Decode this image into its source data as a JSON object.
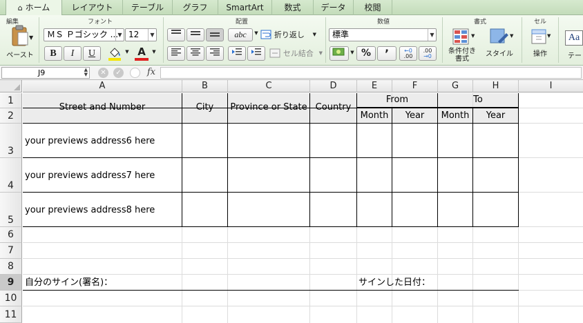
{
  "ribbon_tabs": [
    "ホーム",
    "レイアウト",
    "テーブル",
    "グラフ",
    "SmartArt",
    "数式",
    "データ",
    "校閲"
  ],
  "active_tab": "ホーム",
  "groups": {
    "clipboard": "編集",
    "font": "フォント",
    "alignment": "配置",
    "number": "数値",
    "styles": "書式",
    "cells": "セル"
  },
  "clipboard": {
    "paste_label": "ペースト"
  },
  "font": {
    "name": "ＭＳ Ｐゴシック ...",
    "size": "12",
    "bold": "B",
    "italic": "I",
    "underline": "U",
    "font_color_letter": "A",
    "highlight_color": "#f5e400",
    "font_color": "#e02020"
  },
  "alignment": {
    "orientation_label": "abc",
    "wrap_label": "折り返し",
    "merge_label": "セル結合"
  },
  "number": {
    "format": "標準",
    "percent": "%",
    "comma": "ʼ",
    "inc_decimal": ".00",
    "dec_decimal": ".00"
  },
  "styles": {
    "conditional_line1": "条件付き",
    "conditional_line2": "書式",
    "style_label": "スタイル"
  },
  "cells": {
    "ops_label": "操作"
  },
  "theme": {
    "sample": "Aa",
    "label": "テー"
  },
  "formula_bar": {
    "name_box": "J9",
    "fx": "fx",
    "content": ""
  },
  "columns": [
    "A",
    "B",
    "C",
    "D",
    "E",
    "F",
    "G",
    "H",
    "I"
  ],
  "rows": [
    "1",
    "2",
    "3",
    "4",
    "5",
    "6",
    "7",
    "8",
    "9",
    "10",
    "11"
  ],
  "selected_row": "9",
  "table": {
    "headers": {
      "street": "Street and Number",
      "city": "City",
      "province": "Province or State",
      "country": "Country",
      "from": "From",
      "to": "To",
      "from_month": "Month",
      "from_year": "Year",
      "to_month": "Month",
      "to_year": "Year"
    },
    "addresses": [
      "your previews address6 here",
      "your previews address7 here",
      "your previews address8 here"
    ]
  },
  "signature": {
    "sign_label": "自分のサイン(署名)：",
    "date_label": "サインした日付："
  }
}
